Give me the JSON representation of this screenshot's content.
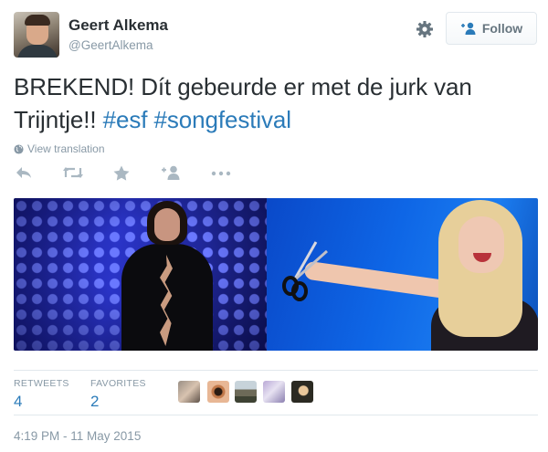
{
  "user": {
    "fullname": "Geert Alkema",
    "username": "@GeertAlkema"
  },
  "follow_button": {
    "label": "Follow",
    "icon": "follow-user-icon"
  },
  "settings_icon": "gear-icon",
  "tweet": {
    "text_prefix": "BREKEND! Dít gebeurde er met de jurk van Trijntje!! ",
    "hashtags": [
      "#esf",
      "#songfestival"
    ]
  },
  "translate": {
    "label": "View translation",
    "icon": "globe-icon"
  },
  "actions": [
    {
      "name": "reply",
      "icon": "reply-icon"
    },
    {
      "name": "retweet",
      "icon": "retweet-icon"
    },
    {
      "name": "favorite",
      "icon": "star-icon"
    },
    {
      "name": "follow",
      "icon": "add-user-icon"
    },
    {
      "name": "more",
      "icon": "more-icon"
    }
  ],
  "stats": {
    "retweets_label": "RETWEETS",
    "retweets_value": "4",
    "favorites_label": "FAVORITES",
    "favorites_value": "2"
  },
  "favoriters": [
    "favoriter-avatar-1",
    "favoriter-avatar-2",
    "favoriter-avatar-3",
    "favoriter-avatar-4",
    "favoriter-avatar-5"
  ],
  "timestamp": "4:19 PM - 11 May 2015",
  "colors": {
    "link": "#2b7bb9",
    "muted": "#8899a6",
    "text": "#292f33",
    "border": "#e1e8ed"
  }
}
